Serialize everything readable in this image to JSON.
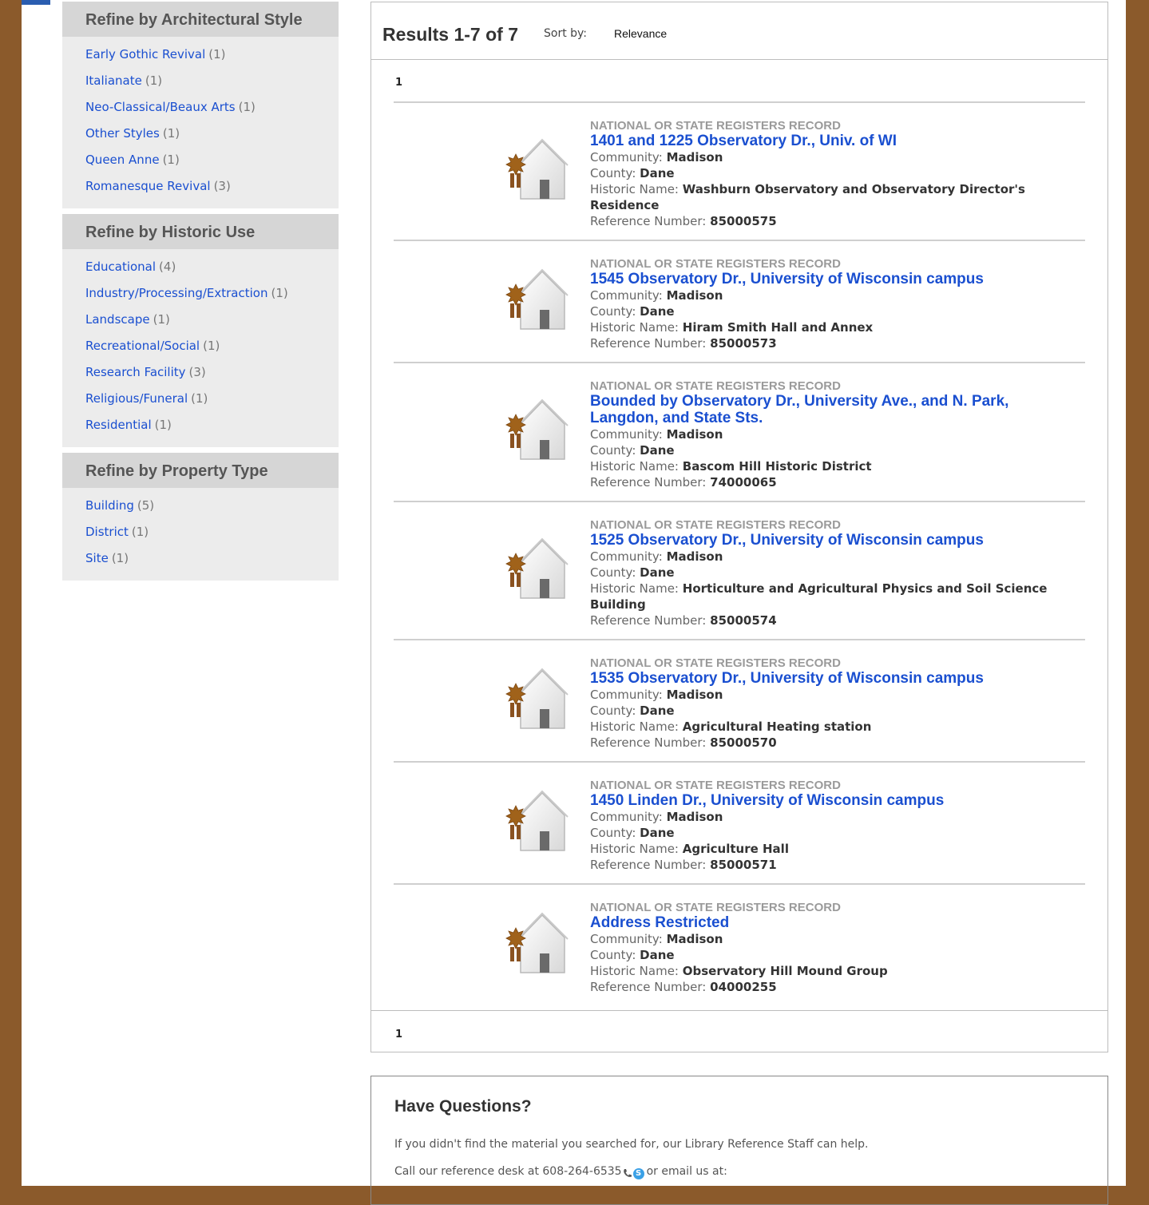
{
  "colors": {
    "background": "#8b5a2b",
    "link": "#1a4fd0",
    "facet_header": "#d6d6d6",
    "facet_body": "#ececec"
  },
  "sidebar": {
    "facets": [
      {
        "title": "Refine by Architectural Style",
        "items": [
          {
            "label": "Early Gothic Revival",
            "count": "(1)"
          },
          {
            "label": "Italianate",
            "count": "(1)"
          },
          {
            "label": "Neo-Classical/Beaux Arts",
            "count": "(1)"
          },
          {
            "label": "Other Styles",
            "count": "(1)"
          },
          {
            "label": "Queen Anne",
            "count": "(1)"
          },
          {
            "label": "Romanesque Revival",
            "count": "(3)"
          }
        ]
      },
      {
        "title": "Refine by Historic Use",
        "items": [
          {
            "label": "Educational",
            "count": "(4)"
          },
          {
            "label": "Industry/Processing/Extraction",
            "count": "(1)"
          },
          {
            "label": "Landscape",
            "count": "(1)"
          },
          {
            "label": "Recreational/Social",
            "count": "(1)"
          },
          {
            "label": "Research Facility",
            "count": "(3)"
          },
          {
            "label": "Religious/Funeral",
            "count": "(1)"
          },
          {
            "label": "Residential",
            "count": "(1)"
          }
        ]
      },
      {
        "title": "Refine by Property Type",
        "items": [
          {
            "label": "Building",
            "count": "(5)"
          },
          {
            "label": "District",
            "count": "(1)"
          },
          {
            "label": "Site",
            "count": "(1)"
          }
        ]
      }
    ]
  },
  "results": {
    "title": "Results 1-7 of 7",
    "sort_label": "Sort by:",
    "sort_value": "Relevance",
    "pager_top": "1",
    "pager_bottom": "1",
    "field_labels": {
      "community": "Community:",
      "county": "County:",
      "historic_name": "Historic Name:",
      "reference_number": "Reference Number:"
    },
    "records": [
      {
        "type": "NATIONAL OR STATE REGISTERS RECORD",
        "icon": "historic-house-icon",
        "title": "1401 and 1225 Observatory Dr., Univ. of WI",
        "community": "Madison",
        "county": "Dane",
        "historic_name": "Washburn Observatory and Observatory Director's Residence",
        "reference_number": "85000575"
      },
      {
        "type": "NATIONAL OR STATE REGISTERS RECORD",
        "icon": "historic-house-icon",
        "title": "1545 Observatory Dr., University of Wisconsin campus",
        "community": "Madison",
        "county": "Dane",
        "historic_name": "Hiram Smith Hall and Annex",
        "reference_number": "85000573"
      },
      {
        "type": "NATIONAL OR STATE REGISTERS RECORD",
        "icon": "historic-house-icon",
        "title": "Bounded by Observatory Dr., University Ave., and N. Park, Langdon, and State Sts.",
        "community": "Madison",
        "county": "Dane",
        "historic_name": "Bascom Hill Historic District",
        "reference_number": "74000065"
      },
      {
        "type": "NATIONAL OR STATE REGISTERS RECORD",
        "icon": "historic-house-icon",
        "title": "1525 Observatory Dr., University of Wisconsin campus",
        "community": "Madison",
        "county": "Dane",
        "historic_name": "Horticulture and Agricultural Physics and Soil Science Building",
        "reference_number": "85000574"
      },
      {
        "type": "NATIONAL OR STATE REGISTERS RECORD",
        "icon": "historic-house-icon",
        "title": "1535 Observatory Dr., University of Wisconsin campus",
        "community": "Madison",
        "county": "Dane",
        "historic_name": "Agricultural Heating station",
        "reference_number": "85000570"
      },
      {
        "type": "NATIONAL OR STATE REGISTERS RECORD",
        "icon": "historic-house-icon",
        "title": "1450 Linden Dr., University of Wisconsin campus",
        "community": "Madison",
        "county": "Dane",
        "historic_name": "Agriculture Hall",
        "reference_number": "85000571"
      },
      {
        "type": "NATIONAL OR STATE REGISTERS RECORD",
        "icon": "historic-house-icon",
        "title": "Address Restricted",
        "community": "Madison",
        "county": "Dane",
        "historic_name": "Observatory Hill Mound Group",
        "reference_number": "04000255"
      }
    ]
  },
  "questions": {
    "title": "Have Questions?",
    "line1": "If you didn't find the material you searched for, our Library Reference Staff can help.",
    "line2_prefix": "Call our reference desk at 608-264-6535",
    "line2_suffix": "or email us at:",
    "icons": [
      "phone-icon",
      "skype-icon"
    ]
  }
}
